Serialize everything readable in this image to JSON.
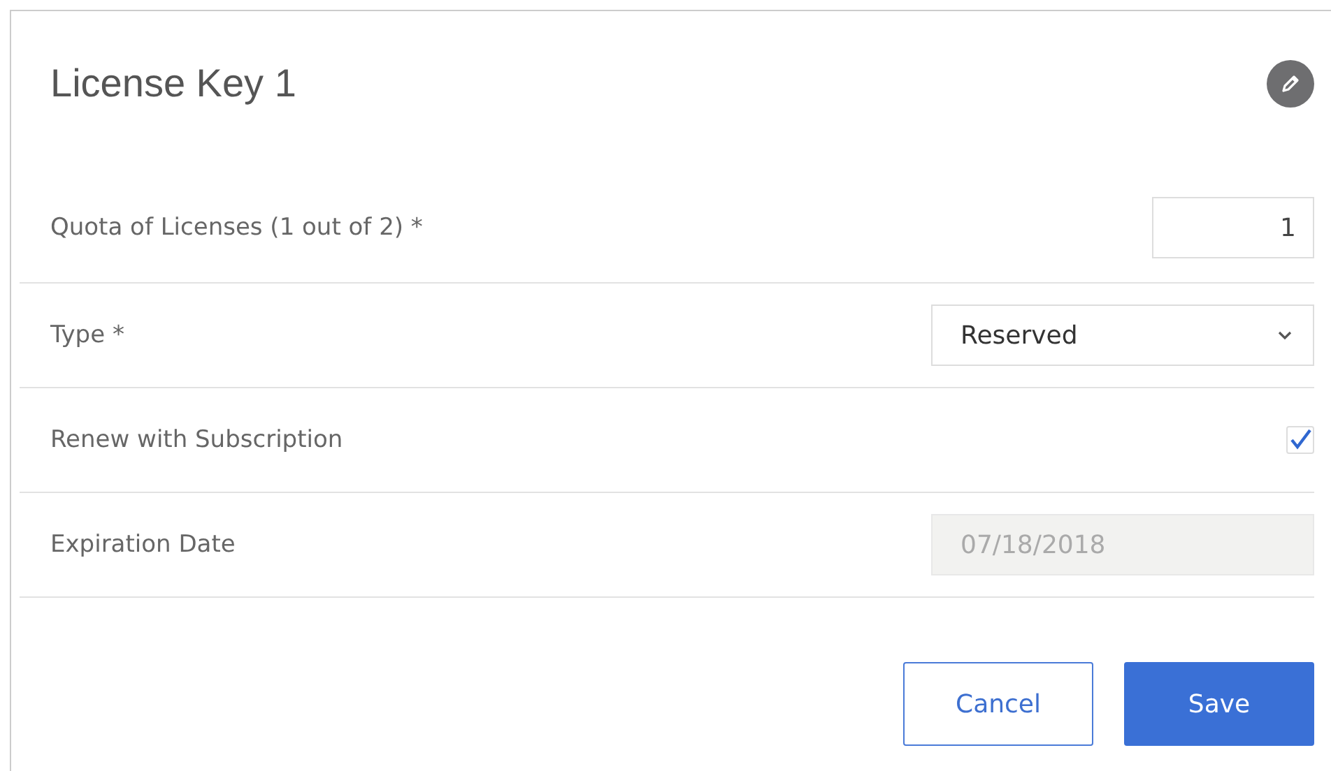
{
  "title": "License Key 1",
  "fields": [
    {
      "kind": "number",
      "label": "Quota of Licenses (1 out of 2) *",
      "value": "1"
    },
    {
      "kind": "select",
      "label": "Type *",
      "value": "Reserved"
    },
    {
      "kind": "checkbox",
      "label": "Renew with Subscription",
      "checked": true
    },
    {
      "kind": "date",
      "label": "Expiration Date",
      "value": "07/18/2018",
      "disabled": true
    }
  ],
  "buttons": [
    {
      "kind": "secondary",
      "label": "Cancel"
    },
    {
      "kind": "primary",
      "label": "Save"
    }
  ]
}
